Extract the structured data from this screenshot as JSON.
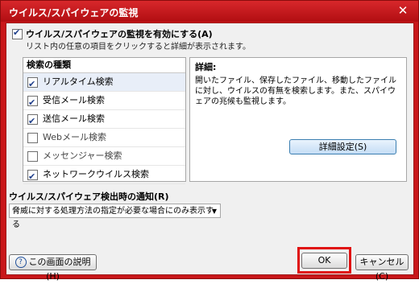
{
  "window": {
    "title": "ウイルス/スパイウェアの監視",
    "close_icon": "close-icon"
  },
  "main_toggle": {
    "label": "ウイルス/スパイウェアの監視を有効にする(A)",
    "checked": true,
    "hint": "リスト内の任意の項目をクリックすると詳細が表示されます。"
  },
  "scan_list": {
    "header": "検索の種類",
    "items": [
      {
        "label": "リアルタイム検索",
        "checked": true
      },
      {
        "label": "受信メール検索",
        "checked": true
      },
      {
        "label": "送信メール検索",
        "checked": true
      },
      {
        "label": "Webメール検索",
        "checked": false
      },
      {
        "label": "メッセンジャー検索",
        "checked": false
      },
      {
        "label": "ネットワークウイルス検索",
        "checked": true
      }
    ]
  },
  "details": {
    "title": "詳細:",
    "text": "開いたファイル、保存したファイル、移動したファイルに対し、ウイルスの有無を検索します。また、スパイウェアの兆候も監視します。",
    "button_label": "詳細設定(S)"
  },
  "notification": {
    "label": "ウイルス/スパイウェア検出時の通知(R)",
    "selected": "脅威に対する処理方法の指定が必要な場合にのみ表示する"
  },
  "footer": {
    "help_label": "この画面の説明(H)",
    "ok_label": "OK",
    "cancel_label": "キャンセル(C)"
  },
  "colors": {
    "titlebar": "#c9171a",
    "highlight": "#e01010",
    "accent_button": "#c5ddf5"
  }
}
